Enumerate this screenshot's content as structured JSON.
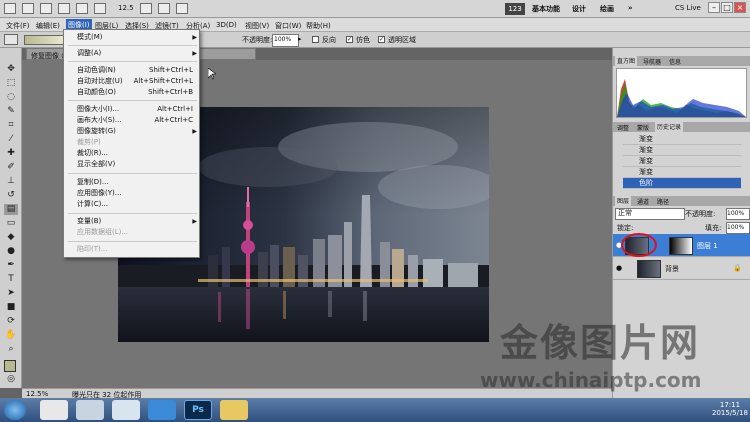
{
  "app": {
    "menus": [
      "文件(F)",
      "编辑(E)",
      "图像(I)",
      "图层(L)",
      "选择(S)",
      "滤镜(T)",
      "分析(A)",
      "3D(D)",
      "视图(V)",
      "窗口(W)",
      "帮助(H)"
    ],
    "zoom_display": "12.5",
    "badge": "123",
    "workspaces": [
      "基本功能",
      "设计",
      "绘画"
    ],
    "cs_live": "CS Live"
  },
  "options": {
    "opacity_label": "不透明度:",
    "opacity_value": "100%",
    "reverse_label": "反向",
    "dither_label": "仿色",
    "transparency_label": "透明区域"
  },
  "document": {
    "tab_title": "修复图像 @ 12.5%(RGB/8*)",
    "zoom": "12.5%",
    "status": "曝光只在 32 位起作用"
  },
  "image_menu": {
    "items": [
      {
        "label": "模式(M)",
        "shortcut": "",
        "submenu": true,
        "disabled": false
      },
      {
        "label": "调整(A)",
        "shortcut": "",
        "submenu": true,
        "disabled": false
      },
      {
        "label": "自动色调(N)",
        "shortcut": "Shift+Ctrl+L",
        "submenu": false,
        "disabled": false
      },
      {
        "label": "自动对比度(U)",
        "shortcut": "Alt+Shift+Ctrl+L",
        "submenu": false,
        "disabled": false
      },
      {
        "label": "自动颜色(O)",
        "shortcut": "Shift+Ctrl+B",
        "submenu": false,
        "disabled": false
      },
      {
        "label": "图像大小(I)...",
        "shortcut": "Alt+Ctrl+I",
        "submenu": false,
        "disabled": false
      },
      {
        "label": "画布大小(S)...",
        "shortcut": "Alt+Ctrl+C",
        "submenu": false,
        "disabled": false
      },
      {
        "label": "图像旋转(G)",
        "shortcut": "",
        "submenu": true,
        "disabled": false
      },
      {
        "label": "裁剪(P)",
        "shortcut": "",
        "submenu": false,
        "disabled": true
      },
      {
        "label": "裁切(R)...",
        "shortcut": "",
        "submenu": false,
        "disabled": false
      },
      {
        "label": "显示全部(V)",
        "shortcut": "",
        "submenu": false,
        "disabled": false
      },
      {
        "label": "复制(D)...",
        "shortcut": "",
        "submenu": false,
        "disabled": false
      },
      {
        "label": "应用图像(Y)...",
        "shortcut": "",
        "submenu": false,
        "disabled": false
      },
      {
        "label": "计算(C)...",
        "shortcut": "",
        "submenu": false,
        "disabled": false
      },
      {
        "label": "变量(B)",
        "shortcut": "",
        "submenu": true,
        "disabled": false
      },
      {
        "label": "应用数据组(L)...",
        "shortcut": "",
        "submenu": false,
        "disabled": true
      },
      {
        "label": "陷印(T)...",
        "shortcut": "",
        "submenu": false,
        "disabled": true
      }
    ]
  },
  "panels": {
    "top_tabs": [
      "直方图",
      "导航器",
      "信息"
    ],
    "history_tabs": [
      "调整",
      "蒙版",
      "历史记录"
    ],
    "history": [
      "渐变",
      "渐变",
      "渐变",
      "渐变",
      "色阶"
    ],
    "layer_tabs": [
      "图层",
      "通道",
      "路径"
    ],
    "blend_mode": "正常",
    "opacity_label": "不透明度:",
    "opacity": "100%",
    "lock_label": "锁定:",
    "fill_label": "填充:",
    "fill": "100%",
    "layers": [
      {
        "name": "图层 1",
        "selected": true
      },
      {
        "name": "背景",
        "selected": false
      }
    ]
  },
  "taskbar": {
    "time": "17:11",
    "date": "2015/5/18"
  },
  "watermark": {
    "title": "金像图片网",
    "url": "www.chinaiptp.com"
  },
  "colors": {
    "accent": "#2f63b8",
    "layer_selected": "#3c7ed6",
    "annotation_circle": "#e0101a"
  }
}
